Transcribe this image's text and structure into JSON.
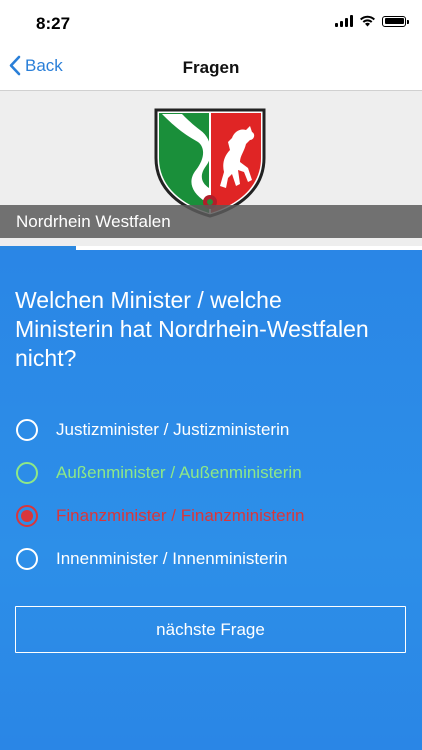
{
  "status_bar": {
    "time": "8:27"
  },
  "nav": {
    "back_label": "Back",
    "title": "Fragen"
  },
  "header": {
    "state_name": "Nordrhein Westfalen",
    "progress": 0.18
  },
  "question": {
    "text": "Welchen Minister / welche Ministerin hat Nordrhein-Westfalen nicht?"
  },
  "answers": [
    {
      "label": "Justizminister / Justizministerin",
      "state": "neutral"
    },
    {
      "label": "Außenminister / Außenministerin",
      "state": "correct"
    },
    {
      "label": "Finanzminister / Finanzministerin",
      "state": "wrong-selected"
    },
    {
      "label": "Innenminister / Innenministerin",
      "state": "neutral"
    }
  ],
  "next_button": {
    "label": "nächste Frage"
  },
  "colors": {
    "accent": "#2a7fd8",
    "background_blue": "#2a86e6",
    "correct": "#8ee887",
    "wrong": "#d9363b"
  }
}
